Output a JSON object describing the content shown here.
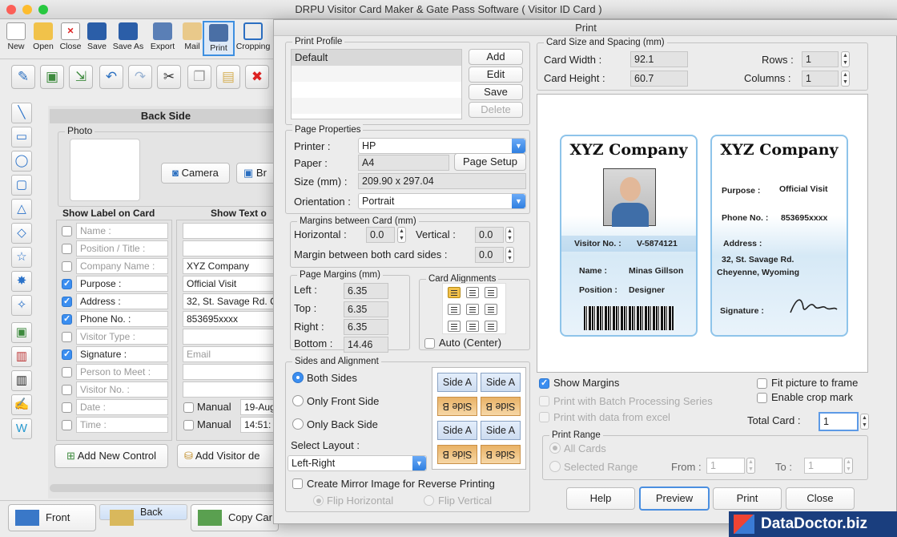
{
  "app": {
    "title": "DRPU Visitor Card Maker & Gate Pass Software ( Visitor ID Card )"
  },
  "toolbar": {
    "items": [
      {
        "label": "New",
        "icon": "new-doc-icon"
      },
      {
        "label": "Open",
        "icon": "folder-open-icon"
      },
      {
        "label": "Close",
        "icon": "close-doc-icon"
      },
      {
        "label": "Save",
        "icon": "save-icon"
      },
      {
        "label": "Save As",
        "icon": "save-as-icon"
      },
      {
        "label": "Export",
        "icon": "export-icon"
      },
      {
        "label": "Mail",
        "icon": "mail-icon"
      },
      {
        "label": "Print",
        "icon": "printer-icon"
      },
      {
        "label": "Cropping",
        "icon": "crop-icon"
      }
    ]
  },
  "editor": {
    "side_title": "Back Side",
    "photo_label": "Photo",
    "camera_btn": "Camera",
    "browse_btn": "Br",
    "col_show_label": "Show Label on Card",
    "col_show_text": "Show Text o",
    "rows": [
      {
        "label": "Name :",
        "checked": false,
        "value": ""
      },
      {
        "label": "Position / Title :",
        "checked": false,
        "value": ""
      },
      {
        "label": "Company Name :",
        "checked": false,
        "value": "XYZ Company"
      },
      {
        "label": "Purpose :",
        "checked": true,
        "value": "Official Visit"
      },
      {
        "label": "Address :",
        "checked": true,
        "value": "32, St. Savage Rd. C"
      },
      {
        "label": "Phone No. :",
        "checked": true,
        "value": "853695xxxx"
      },
      {
        "label": "Visitor Type :",
        "checked": false,
        "value": ""
      },
      {
        "label": "Signature :",
        "checked": true,
        "value": "Email"
      },
      {
        "label": "Person to Meet :",
        "checked": false,
        "value": ""
      },
      {
        "label": "Visitor No. :",
        "checked": false,
        "value": ""
      },
      {
        "label": "Date :",
        "checked": false,
        "value": "19-Aug"
      },
      {
        "label": "Time :",
        "checked": false,
        "value": "14:51:"
      }
    ],
    "manual_label": "Manual",
    "add_control_btn": "Add New Control",
    "add_visitor_btn": "Add Visitor de"
  },
  "bottom_tabs": [
    "Front",
    "Back",
    "Copy Car"
  ],
  "dialog": {
    "title": "Print",
    "print_profile": {
      "legend": "Print Profile",
      "items": [
        "Default"
      ],
      "add": "Add",
      "edit": "Edit",
      "save": "Save",
      "delete": "Delete"
    },
    "page_props": {
      "legend": "Page Properties",
      "printer_label": "Printer :",
      "printer": "HP",
      "paper_label": "Paper :",
      "paper": "A4",
      "page_setup": "Page Setup",
      "size_label": "Size (mm) :",
      "size": "209.90 x 297.04",
      "orientation_label": "Orientation :",
      "orientation": "Portrait"
    },
    "margins_card": {
      "legend": "Margins between Card (mm)",
      "horizontal_label": "Horizontal :",
      "horizontal": "0.0",
      "vertical_label": "Vertical :",
      "vertical": "0.0",
      "both_label": "Margin between both card sides :",
      "both": "0.0"
    },
    "page_margins": {
      "legend": "Page Margins (mm)",
      "left_label": "Left :",
      "left": "6.35",
      "top_label": "Top :",
      "top": "6.35",
      "right_label": "Right :",
      "right": "6.35",
      "bottom_label": "Bottom :",
      "bottom": "14.46"
    },
    "card_align": {
      "legend": "Card Alignments",
      "auto": "Auto (Center)"
    },
    "sides": {
      "legend": "Sides and Alignment",
      "both": "Both Sides",
      "front": "Only Front Side",
      "back": "Only Back Side",
      "layout_label": "Select Layout :",
      "layout": "Left-Right",
      "side_a": "Side A",
      "side_b": "Side B",
      "mirror": "Create Mirror Image for Reverse Printing",
      "flip_h": "Flip Horizontal",
      "flip_v": "Flip Vertical"
    },
    "card_size": {
      "legend": "Card Size and Spacing (mm)",
      "width_label": "Card Width :",
      "width": "92.1",
      "height_label": "Card Height :",
      "height": "60.7",
      "rows_label": "Rows :",
      "rows": "1",
      "cols_label": "Columns :",
      "cols": "1"
    },
    "cards": {
      "front": {
        "company": "XYZ Company",
        "visitor_no_label": "Visitor No. :",
        "visitor_no": "V-5874121",
        "name_label": "Name :",
        "name": "Minas Gillson",
        "position_label": "Position :",
        "position": "Designer"
      },
      "back": {
        "company": "XYZ Company",
        "purpose_label": "Purpose :",
        "purpose": "Official Visit",
        "phone_label": "Phone No. :",
        "phone": "853695xxxx",
        "address_label": "Address :",
        "address1": "32, St. Savage Rd.",
        "address2": "Cheyenne, Wyoming",
        "signature_label": "Signature :"
      }
    },
    "options": {
      "show_margins": "Show Margins",
      "batch": "Print with Batch Processing Series",
      "excel": "Print with data from excel",
      "fit": "Fit picture to frame",
      "crop": "Enable crop mark",
      "total_label": "Total Card :",
      "total": "1"
    },
    "range": {
      "legend": "Print Range",
      "all": "All Cards",
      "selected": "Selected Range",
      "from_label": "From :",
      "from": "1",
      "to_label": "To :",
      "to": "1"
    },
    "buttons": {
      "help": "Help",
      "preview": "Preview",
      "print": "Print",
      "close": "Close"
    }
  },
  "brand": {
    "text": "DataDoctor.biz"
  }
}
